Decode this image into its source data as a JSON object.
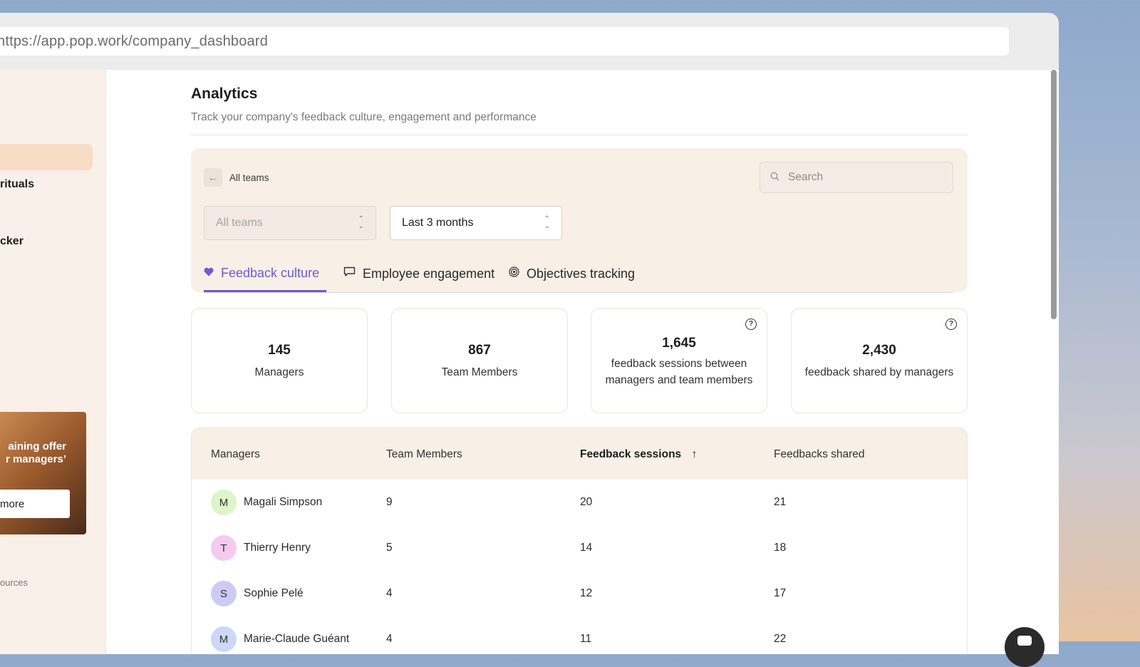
{
  "browser": {
    "url": "https://app.pop.work/company_dashboard"
  },
  "sidebar": {
    "items": [
      {
        "label": "rituals"
      },
      {
        "label": "cker"
      }
    ],
    "promo": {
      "text_line1": "aining offer",
      "text_line2": "r managers’",
      "button": "more"
    },
    "resources": "ources"
  },
  "header": {
    "title": "Analytics",
    "subtitle": "Track your company's feedback culture, engagement and performance"
  },
  "filters": {
    "back_label": "All teams",
    "search_placeholder": "Search",
    "team_select": "All teams",
    "period_select": "Last 3 months"
  },
  "tabs": [
    {
      "label": "Feedback culture",
      "icon": "heart-icon",
      "selected": true
    },
    {
      "label": "Employee engagement",
      "icon": "chat-icon",
      "selected": false
    },
    {
      "label": "Objectives tracking",
      "icon": "target-icon",
      "selected": false
    }
  ],
  "stats": [
    {
      "value": "145",
      "label": "Managers",
      "help": false
    },
    {
      "value": "867",
      "label": "Team Members",
      "help": false
    },
    {
      "value": "1,645",
      "label": "feedback sessions between managers and team members",
      "help": true
    },
    {
      "value": "2,430",
      "label": "feedback shared by managers",
      "help": true
    }
  ],
  "table": {
    "columns": [
      "Managers",
      "Team Members",
      "Feedback sessions",
      "Feedbacks shared"
    ],
    "sort_indicator": "↑",
    "rows": [
      {
        "initial": "M",
        "name": "Magali Simpson",
        "team_members": "9",
        "sessions": "20",
        "shared": "21",
        "avatar_color": "#dcf5c9"
      },
      {
        "initial": "T",
        "name": "Thierry Henry",
        "team_members": "5",
        "sessions": "14",
        "shared": "18",
        "avatar_color": "#f6c9ef"
      },
      {
        "initial": "S",
        "name": "Sophie Pelé",
        "team_members": "4",
        "sessions": "12",
        "shared": "17",
        "avatar_color": "#cfc9f6"
      },
      {
        "initial": "M",
        "name": "Marie-Claude Guéant",
        "team_members": "4",
        "sessions": "11",
        "shared": "22",
        "avatar_color": "#c9d9f6"
      }
    ]
  },
  "colors": {
    "accent": "#6b5ccf",
    "panel": "#f8efe7",
    "sidebar": "#f8f0e9"
  }
}
